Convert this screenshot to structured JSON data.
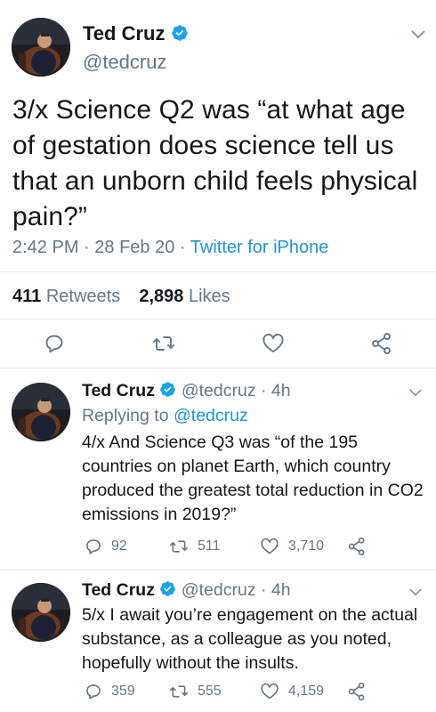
{
  "main_tweet": {
    "name": "Ted Cruz",
    "handle": "@tedcruz",
    "text": "3/x Science Q2 was “at what age of gestation does science tell us that an unborn child feels physical pain?”",
    "time": "2:42 PM",
    "sep1": " · ",
    "date": "28 Feb 20",
    "sep2": " · ",
    "source": "Twitter for iPhone",
    "retweets_count": "411",
    "retweets_label": "Retweets",
    "likes_count": "2,898",
    "likes_label": "Likes"
  },
  "replies": [
    {
      "name": "Ted Cruz",
      "handle": "@tedcruz",
      "sep": " · ",
      "age": "4h",
      "replying_prefix": "Replying to ",
      "replying_to": "@tedcruz",
      "text": "4/x And Science Q3 was “of the 195 countries on planet Earth, which country produced the greatest total reduction in CO2 emissions in 2019?”",
      "replies": "92",
      "retweets": "511",
      "likes": "3,710"
    },
    {
      "name": "Ted Cruz",
      "handle": "@tedcruz",
      "sep": " · ",
      "age": "4h",
      "text": "5/x I await you’re engagement on the actual substance, as a colleague as you noted, hopefully without the insults.",
      "replies": "359",
      "retweets": "555",
      "likes": "4,159"
    }
  ],
  "colors": {
    "link": "#1b95e0",
    "grey": "#657786",
    "text": "#14171a",
    "divider": "#e6ecf0"
  },
  "icons": [
    "verified-badge-icon",
    "chevron-down-icon",
    "reply-icon",
    "retweet-icon",
    "like-icon",
    "share-icon"
  ]
}
